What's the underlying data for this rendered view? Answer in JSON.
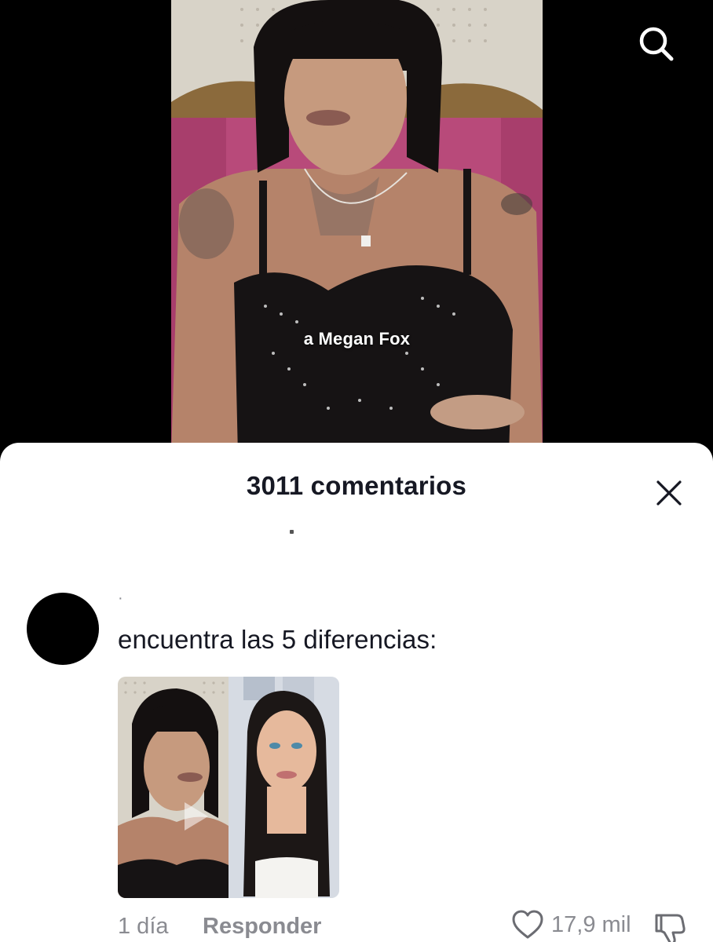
{
  "video": {
    "caption": "a Megan Fox",
    "search_icon": "search-icon"
  },
  "comments_sheet": {
    "title": "3011 comentarios",
    "close_icon": "close-icon",
    "comment": {
      "username": "·",
      "text": "encuentra las 5 diferencias:",
      "image_overlay_icon": "play-icon",
      "time": "1 día",
      "reply_label": "Responder",
      "like_icon": "heart-icon",
      "like_count": "17,9 mil",
      "dislike_icon": "thumbs-down-icon"
    }
  },
  "colors": {
    "sheet_background": "#ffffff",
    "primary_text": "#161823",
    "secondary_text": "#8a8b91",
    "video_background": "#000000"
  }
}
